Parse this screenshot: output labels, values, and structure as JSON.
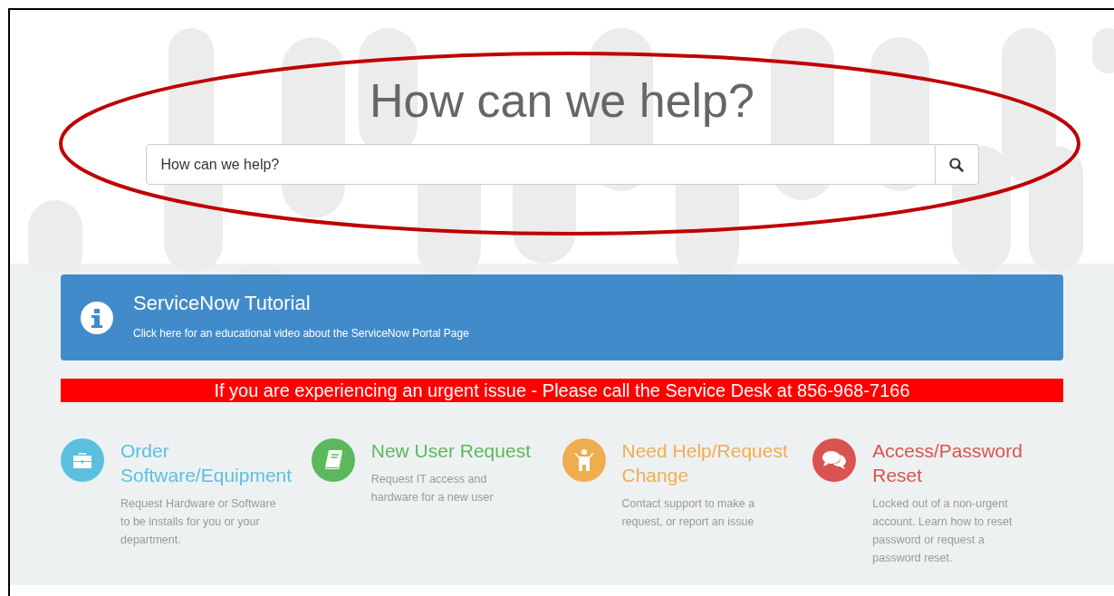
{
  "hero": {
    "title": "How can we help?",
    "search": {
      "placeholder": "How can we help?"
    }
  },
  "tutorial": {
    "title": "ServiceNow Tutorial",
    "link": "Click here for an educational video about the ServiceNow Portal Page"
  },
  "alert": "If you are experiencing an urgent issue - Please call the Service Desk at 856-968-7166",
  "tiles": [
    {
      "title": "Order Software/Equipment",
      "description": "Request Hardware or Software to be installs for you or your department.",
      "color": "#5bc0de"
    },
    {
      "title": "New User Request",
      "description": "Request IT access and hardware for a new user",
      "color": "#5cb85c"
    },
    {
      "title": "Need Help/Request Change",
      "description": "Contact support to make a request, or report an issue",
      "color": "#f0ad4e"
    },
    {
      "title": "Access/Password Reset",
      "description": "Locked out of a non-urgent account. Learn how to reset password or request a password reset.",
      "color": "#d9534f"
    }
  ]
}
